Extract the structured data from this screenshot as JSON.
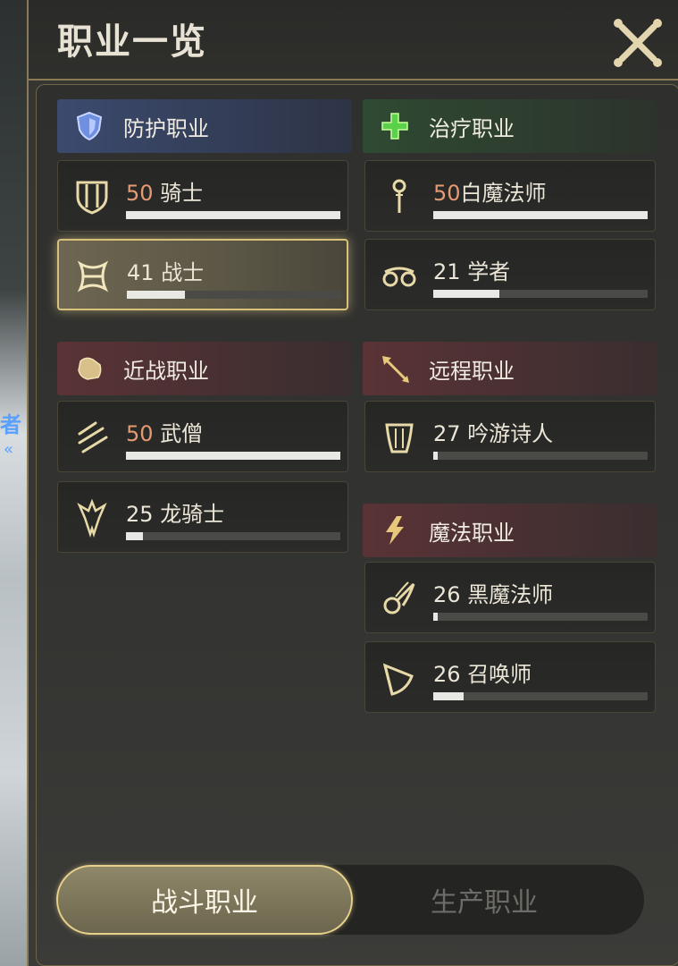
{
  "window": {
    "title": "职业一览"
  },
  "background": {
    "text1": "者",
    "text2": "«"
  },
  "categories": [
    {
      "key": "tank",
      "label": "防护职业",
      "icon": "shield-icon"
    },
    {
      "key": "heal",
      "label": "治疗职业",
      "icon": "green-cross-icon"
    },
    {
      "key": "melee",
      "label": "近战职业",
      "icon": "fist-icon"
    },
    {
      "key": "ranged",
      "label": "远程职业",
      "icon": "arrow-icon"
    },
    {
      "key": "magic",
      "label": "魔法职业",
      "icon": "lightning-icon"
    }
  ],
  "jobs": [
    {
      "key": "paladin",
      "level": "50",
      "name": "骑士",
      "max": true,
      "progress": 1.0,
      "icon": "paladin-shield-icon"
    },
    {
      "key": "whitemage",
      "level": "50",
      "name": "白魔法师",
      "max": true,
      "progress": 1.0,
      "icon": "staff-icon"
    },
    {
      "key": "warrior",
      "level": "41",
      "name": "战士",
      "max": false,
      "progress": 0.27,
      "icon": "axe-icon",
      "selected": true
    },
    {
      "key": "scholar",
      "level": "21",
      "name": "学者",
      "max": false,
      "progress": 0.31,
      "icon": "scholar-icon"
    },
    {
      "key": "monk",
      "level": "50",
      "name": "武僧",
      "max": true,
      "progress": 1.0,
      "icon": "claw-icon"
    },
    {
      "key": "bard",
      "level": "27",
      "name": "吟游诗人",
      "max": false,
      "progress": 0.02,
      "icon": "harp-icon"
    },
    {
      "key": "dragoon",
      "level": "25",
      "name": "龙骑士",
      "max": false,
      "progress": 0.08,
      "icon": "dragon-icon"
    },
    {
      "key": "blackmage",
      "level": "26",
      "name": "黑魔法师",
      "max": false,
      "progress": 0.02,
      "icon": "flame-icon"
    },
    {
      "key": "summoner",
      "level": "26",
      "name": "召唤师",
      "max": false,
      "progress": 0.14,
      "icon": "horn-icon"
    }
  ],
  "tabs": {
    "combat": "战斗职业",
    "craft": "生产职业"
  },
  "colors": {
    "accent_gold": "#d8c27a",
    "max_level": "#e59a73",
    "tank": "#3b4a6e",
    "heal": "#2f4a32",
    "dps": "#5a3336"
  }
}
